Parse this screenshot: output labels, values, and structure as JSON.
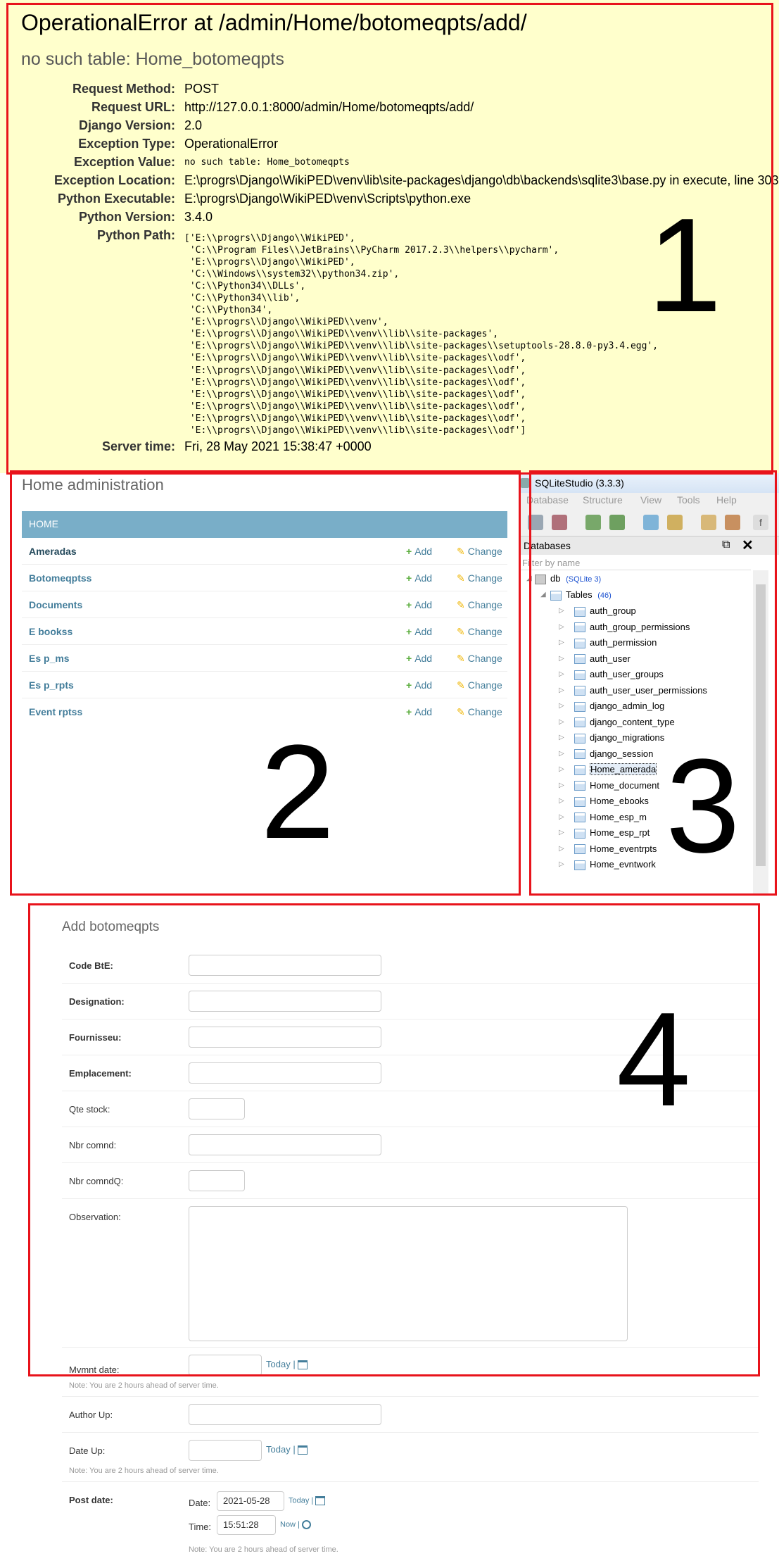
{
  "error": {
    "title": "OperationalError at /admin/Home/botomeqpts/add/",
    "subtitle": "no such table: Home_botomeqpts",
    "meta": [
      {
        "key": "Request Method:",
        "value": "POST",
        "mono": false
      },
      {
        "key": "Request URL:",
        "value": "http://127.0.0.1:8000/admin/Home/botomeqpts/add/",
        "mono": false
      },
      {
        "key": "Django Version:",
        "value": "2.0",
        "mono": false
      },
      {
        "key": "Exception Type:",
        "value": "OperationalError",
        "mono": false
      },
      {
        "key": "Exception Value:",
        "value": "no such table: Home_botomeqpts",
        "mono": true
      },
      {
        "key": "Exception Location:",
        "value": "E:\\progrs\\Django\\WikiPED\\venv\\lib\\site-packages\\django\\db\\backends\\sqlite3\\base.py in execute, line 303",
        "mono": false
      },
      {
        "key": "Python Executable:",
        "value": "E:\\progrs\\Django\\WikiPED\\venv\\Scripts\\python.exe",
        "mono": false
      },
      {
        "key": "Python Version:",
        "value": "3.4.0",
        "mono": false
      }
    ],
    "python_path_label": "Python Path:",
    "python_path": "['E:\\\\progrs\\\\Django\\\\WikiPED',\n 'C:\\\\Program Files\\\\JetBrains\\\\PyCharm 2017.2.3\\\\helpers\\\\pycharm',\n 'E:\\\\progrs\\\\Django\\\\WikiPED',\n 'C:\\\\Windows\\\\system32\\\\python34.zip',\n 'C:\\\\Python34\\\\DLLs',\n 'C:\\\\Python34\\\\lib',\n 'C:\\\\Python34',\n 'E:\\\\progrs\\\\Django\\\\WikiPED\\\\venv',\n 'E:\\\\progrs\\\\Django\\\\WikiPED\\\\venv\\\\lib\\\\site-packages',\n 'E:\\\\progrs\\\\Django\\\\WikiPED\\\\venv\\\\lib\\\\site-packages\\\\setuptools-28.8.0-py3.4.egg',\n 'E:\\\\progrs\\\\Django\\\\WikiPED\\\\venv\\\\lib\\\\site-packages\\\\odf',\n 'E:\\\\progrs\\\\Django\\\\WikiPED\\\\venv\\\\lib\\\\site-packages\\\\odf',\n 'E:\\\\progrs\\\\Django\\\\WikiPED\\\\venv\\\\lib\\\\site-packages\\\\odf',\n 'E:\\\\progrs\\\\Django\\\\WikiPED\\\\venv\\\\lib\\\\site-packages\\\\odf',\n 'E:\\\\progrs\\\\Django\\\\WikiPED\\\\venv\\\\lib\\\\site-packages\\\\odf',\n 'E:\\\\progrs\\\\Django\\\\WikiPED\\\\venv\\\\lib\\\\site-packages\\\\odf',\n 'E:\\\\progrs\\\\Django\\\\WikiPED\\\\venv\\\\lib\\\\site-packages\\\\odf']",
    "server_time_label": "Server time:",
    "server_time": "Fri, 28 May 2021 15:38:47 +0000"
  },
  "annotations": {
    "n1": "1",
    "n2": "2",
    "n3": "3",
    "n4": "4",
    "color": "#e8131b"
  },
  "admin": {
    "title": "Home administration",
    "caption": "HOME",
    "add_label": "Add",
    "change_label": "Change",
    "models": [
      "Ameradas",
      "Botomeqptss",
      "Documents",
      "E bookss",
      "Es p_ms",
      "Es p_rpts",
      "Event rptss"
    ],
    "colors": {
      "caption_bg": "#79aec8",
      "link": "#447e9b",
      "add": "#5cae3e",
      "change": "#efb80b"
    }
  },
  "sqlite": {
    "window_title": "SQLiteStudio (3.3.3)",
    "menu": [
      "Database",
      "Structure",
      "View",
      "Tools",
      "Help"
    ],
    "panel_title": "Databases",
    "filter_placeholder": "Filter by name",
    "db_name": "db",
    "db_type": "(SQLite 3)",
    "tables_label": "Tables",
    "tables_count": "(46)",
    "tables": [
      "auth_group",
      "auth_group_permissions",
      "auth_permission",
      "auth_user",
      "auth_user_groups",
      "auth_user_user_permissions",
      "django_admin_log",
      "django_content_type",
      "django_migrations",
      "django_session",
      "Home_amerada",
      "Home_document",
      "Home_ebooks",
      "Home_esp_m",
      "Home_esp_rpt",
      "Home_eventrpts",
      "Home_evntwork"
    ],
    "selected_table": "Home_amerada"
  },
  "form": {
    "title": "Add botomeqpts",
    "fields": {
      "code_bte": "Code BtE:",
      "designation": "Designation:",
      "fournisseu": "Fournisseu:",
      "emplacement": "Emplacement:",
      "qte_stock": "Qte stock:",
      "nbr_comnd": "Nbr comnd:",
      "nbr_comndq": "Nbr comndQ:",
      "observation": "Observation:",
      "mvmnt_date": "Mvmnt date:",
      "author_up": "Author Up:",
      "date_up": "Date Up:",
      "post_date": "Post date:"
    },
    "today": "Today",
    "now": "Now",
    "sep": "|",
    "note": "Note: You are 2 hours ahead of server time.",
    "date_label": "Date:",
    "time_label": "Time:",
    "post_date_value": "2021-05-28",
    "post_time_value": "15:51:28"
  }
}
